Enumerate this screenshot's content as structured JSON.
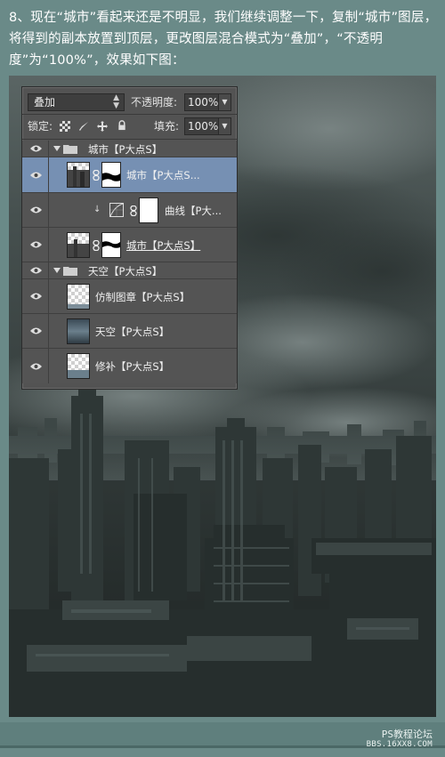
{
  "instruction": "8、现在“城市”看起来还是不明显，我们继续调整一下，复制“城市”图层，将得到的副本放置到顶层，更改图层混合模式为“叠加”，“不透明度”为“100%”，效果如下图：",
  "panel": {
    "blend_mode": "叠加",
    "opacity_label": "不透明度:",
    "opacity_value": "100%",
    "lock_label": "锁定:",
    "fill_label": "填充:",
    "fill_value": "100%",
    "layers": [
      {
        "type": "group",
        "name": "城市【P大点S】",
        "visible": true,
        "expanded": true
      },
      {
        "type": "layer",
        "name": "城市【P大点S...",
        "visible": true,
        "selected": true,
        "has_mask": true
      },
      {
        "type": "adjustment",
        "name": "曲线【P大...",
        "visible": true,
        "clipped": true,
        "has_mask": true
      },
      {
        "type": "layer",
        "name": "城市【P大点S】",
        "visible": true,
        "has_mask": true
      },
      {
        "type": "group",
        "name": "天空【P大点S】",
        "visible": true,
        "expanded": true
      },
      {
        "type": "layer",
        "name": "仿制图章【P大点S】",
        "visible": true
      },
      {
        "type": "layer",
        "name": "天空【P大点S】",
        "visible": true
      },
      {
        "type": "layer",
        "name": "修补【P大点S】",
        "visible": true
      }
    ]
  },
  "watermark": {
    "line1": "PS教程论坛",
    "line2": "BBS.16XX8.COM"
  },
  "colors": {
    "page_background": "#6a8a88",
    "panel_background": "#535353",
    "selected_row": "#7690b3"
  }
}
